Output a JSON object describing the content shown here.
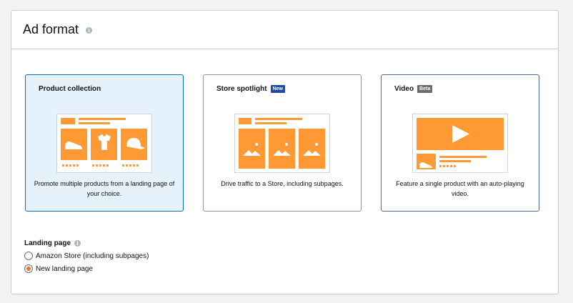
{
  "panel": {
    "title": "Ad format",
    "info_glyph": "i"
  },
  "colors": {
    "accent_orange": "#ff9933",
    "selected_border": "#0a6ebd",
    "selected_bg": "#e6f2fb",
    "radio_checked": "#e8742c",
    "badge_new": "#1f4aa3",
    "badge_beta": "#6b6b6b"
  },
  "cards": [
    {
      "title": "Product collection",
      "badge": "",
      "description": "Promote multiple products from a landing page of your choice.",
      "selected": true,
      "icon": "product-collection-illustration"
    },
    {
      "title": "Store spotlight",
      "badge": "New",
      "description": "Drive traffic to a Store, including subpages.",
      "selected": false,
      "icon": "store-spotlight-illustration"
    },
    {
      "title": "Video",
      "badge": "Beta",
      "description": "Feature a single product with an auto-playing video.",
      "selected": false,
      "icon": "video-illustration"
    }
  ],
  "landing_page": {
    "label": "Landing page",
    "info_glyph": "i",
    "options": [
      {
        "label": "Amazon Store (including subpages)",
        "checked": false
      },
      {
        "label": "New landing page",
        "checked": true
      }
    ]
  }
}
